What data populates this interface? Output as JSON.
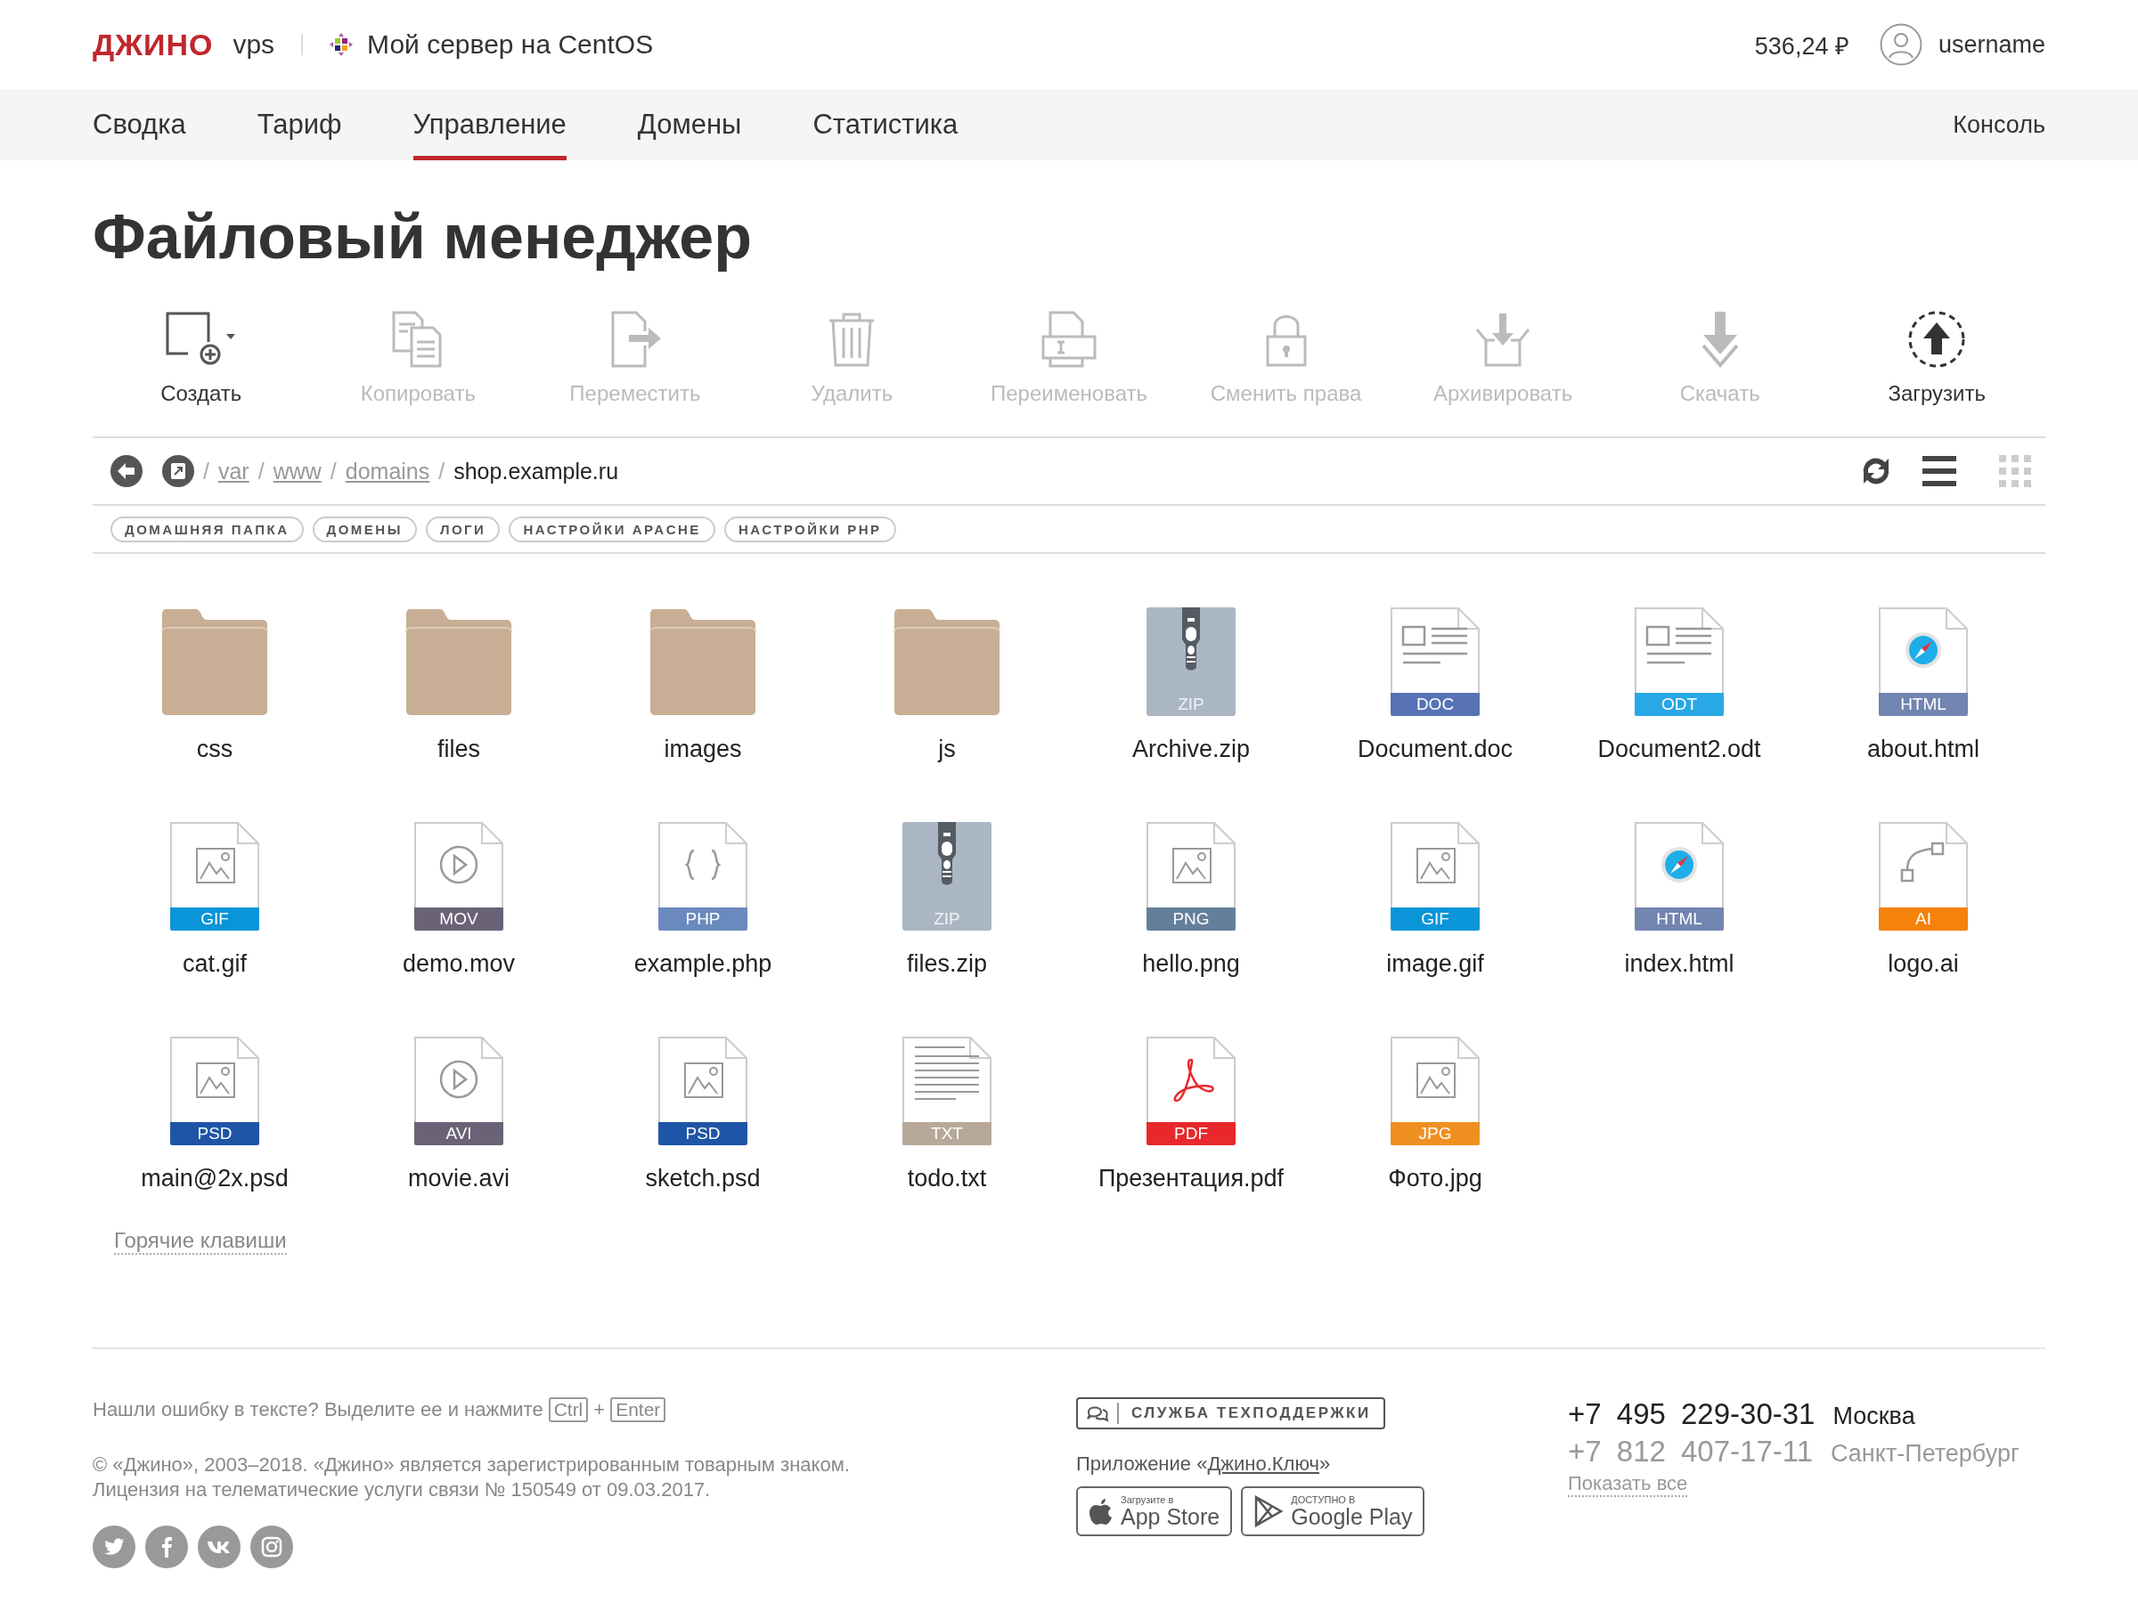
{
  "header": {
    "logo": "ДЖИНО",
    "product": "vps",
    "server_name": "Мой сервер на CentOS",
    "balance": "536,24 ₽",
    "username": "username"
  },
  "nav": {
    "items": [
      {
        "label": "Сводка",
        "selected": false
      },
      {
        "label": "Тариф",
        "selected": false
      },
      {
        "label": "Управление",
        "selected": true
      },
      {
        "label": "Домены",
        "selected": false
      },
      {
        "label": "Статистика",
        "selected": false
      }
    ],
    "console": "Консоль"
  },
  "title": "Файловый менеджер",
  "toolbar": [
    {
      "kind": "create",
      "label": "Создать",
      "disabled": false
    },
    {
      "kind": "copy",
      "label": "Копировать",
      "disabled": true
    },
    {
      "kind": "move",
      "label": "Переместить",
      "disabled": true
    },
    {
      "kind": "delete",
      "label": "Удалить",
      "disabled": true
    },
    {
      "kind": "rename",
      "label": "Переименовать",
      "disabled": true
    },
    {
      "kind": "permissions",
      "label": "Сменить права",
      "disabled": true
    },
    {
      "kind": "archive",
      "label": "Архивировать",
      "disabled": true
    },
    {
      "kind": "download",
      "label": "Скачать",
      "disabled": true
    },
    {
      "kind": "upload",
      "label": "Загрузить",
      "disabled": false
    }
  ],
  "path": {
    "separator": "/",
    "segments": [
      {
        "label": "var",
        "link": true
      },
      {
        "label": "www",
        "link": true
      },
      {
        "label": "domains",
        "link": true
      },
      {
        "label": "shop.example.ru",
        "link": false
      }
    ],
    "views": [
      {
        "kind": "list",
        "selected": true
      },
      {
        "kind": "grid",
        "selected": false
      }
    ]
  },
  "bookmarks": [
    "ДОМАШНЯЯ ПАПКА",
    "ДОМЕНЫ",
    "ЛОГИ",
    "НАСТРОЙКИ APACHE",
    "НАСТРОЙКИ PHP"
  ],
  "files": [
    {
      "name": "css",
      "kind": "folder"
    },
    {
      "name": "files",
      "kind": "folder"
    },
    {
      "name": "images",
      "kind": "folder"
    },
    {
      "name": "js",
      "kind": "folder"
    },
    {
      "name": "Archive.zip",
      "kind": "archive",
      "type": "ZIP",
      "color": "#aab6c3"
    },
    {
      "name": "Document.doc",
      "kind": "document",
      "type": "DOC",
      "color": "#5672b5"
    },
    {
      "name": "Document2.odt",
      "kind": "document",
      "type": "ODT",
      "color": "#29a8e6"
    },
    {
      "name": "about.html",
      "kind": "web",
      "type": "HTML",
      "color": "#7284b0"
    },
    {
      "name": "cat.gif",
      "kind": "image",
      "type": "GIF",
      "color": "#0a95d9"
    },
    {
      "name": "demo.mov",
      "kind": "video",
      "type": "MOV",
      "color": "#6a6378"
    },
    {
      "name": "example.php",
      "kind": "code",
      "type": "PHP",
      "color": "#6a89bd"
    },
    {
      "name": "files.zip",
      "kind": "archive",
      "type": "ZIP",
      "color": "#aab6c3"
    },
    {
      "name": "hello.png",
      "kind": "image",
      "type": "PNG",
      "color": "#637f9b"
    },
    {
      "name": "image.gif",
      "kind": "image",
      "type": "GIF",
      "color": "#0a95d9"
    },
    {
      "name": "index.html",
      "kind": "web",
      "type": "HTML",
      "color": "#7284b0"
    },
    {
      "name": "logo.ai",
      "kind": "vector",
      "type": "AI",
      "color": "#f5820b"
    },
    {
      "name": "main@2x.psd",
      "kind": "image",
      "type": "PSD",
      "color": "#1f55a6"
    },
    {
      "name": "movie.avi",
      "kind": "video",
      "type": "AVI",
      "color": "#6a6378"
    },
    {
      "name": "sketch.psd",
      "kind": "image",
      "type": "PSD",
      "color": "#1f55a6"
    },
    {
      "name": "todo.txt",
      "kind": "text",
      "type": "TXT",
      "color": "#b8a89a"
    },
    {
      "name": "Презентация.pdf",
      "kind": "pdf",
      "type": "PDF",
      "color": "#e8282b"
    },
    {
      "name": "Фото.jpg",
      "kind": "image",
      "type": "JPG",
      "color": "#ef8f22"
    }
  ],
  "hotkeys_link": "Горячие клавиши",
  "footer": {
    "error_note": {
      "text": "Нашли ошибку в тексте? Выделите ее и нажмите",
      "keys": [
        "Ctrl",
        "Enter"
      ],
      "joiner": "+"
    },
    "copyright": [
      "© «Джино», 2003–2018. «Джино» является зарегистрированным товарным знаком.",
      "Лицензия на телематические услуги связи № 150549 от 09.03.2017."
    ],
    "social": [
      {
        "kind": "twitter"
      },
      {
        "kind": "facebook"
      },
      {
        "kind": "vk"
      },
      {
        "kind": "instagram"
      }
    ],
    "support_button": "СЛУЖБА ТЕХПОДДЕРЖКИ",
    "app_promo": {
      "prefix": "Приложение «",
      "link": "Джино.Ключ",
      "suffix": "»"
    },
    "stores": [
      {
        "kind": "apple",
        "caption": "Загрузите в",
        "name": "App Store"
      },
      {
        "kind": "google",
        "caption": "ДОСТУПНО В",
        "name": "Google Play"
      }
    ],
    "phones": [
      {
        "number": "+7 495 229-30-31",
        "city": "Москва",
        "primary": true
      },
      {
        "number": "+7 812 407-17-11",
        "city": "Санкт-Петербург",
        "primary": false
      }
    ],
    "show_all": "Показать все"
  }
}
